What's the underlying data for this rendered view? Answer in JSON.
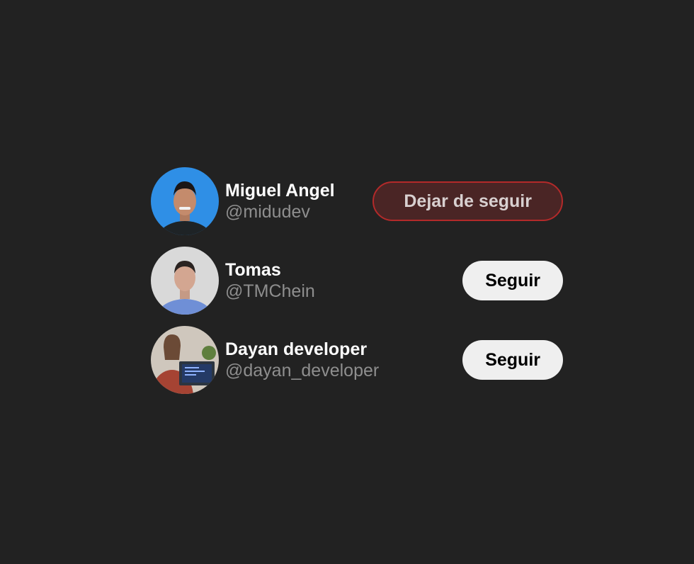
{
  "colors": {
    "background": "#222222",
    "name_text": "#ffffff",
    "handle_text": "#8e8e8e",
    "follow_bg": "#efefef",
    "unfollow_bg": "#4a2525",
    "unfollow_border": "#b32a2a"
  },
  "users": [
    {
      "name": "Miguel Angel",
      "handle": "@midudev",
      "button_label": "Dejar de seguir",
      "following": true,
      "avatar_icon": "avatar-photo"
    },
    {
      "name": "Tomas",
      "handle": "@TMChein",
      "button_label": "Seguir",
      "following": false,
      "avatar_icon": "avatar-photo"
    },
    {
      "name": "Dayan developer",
      "handle": "@dayan_developer",
      "button_label": "Seguir",
      "following": false,
      "avatar_icon": "avatar-photo"
    }
  ]
}
